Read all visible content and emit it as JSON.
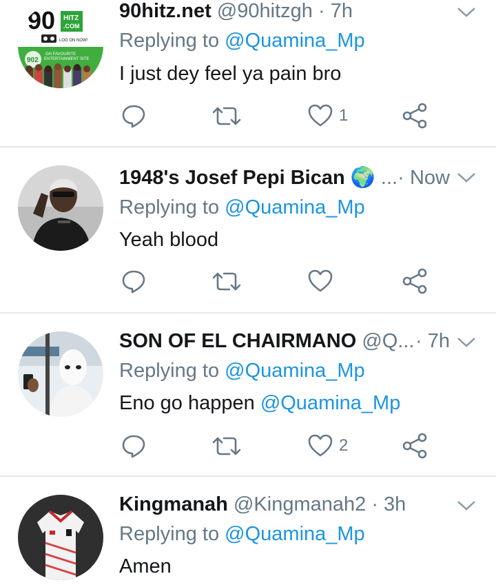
{
  "colors": {
    "link": "#1b95e0",
    "secondary": "#657786",
    "text": "#14171a",
    "divider": "#e4e8eb"
  },
  "tweets": [
    {
      "name": "90hitz.net",
      "handle": "@90hitzgh",
      "separator": "·",
      "time": "7h",
      "replying_prefix": "Replying to",
      "replying_to": "@Quamina_Mp",
      "text": "I just dey feel ya pain bro",
      "like_count": "1",
      "avatar": {
        "logo_big": "90",
        "logo_hitz": "HITZ",
        "logo_com": ".COM",
        "log_on": "LOG ON NOW!",
        "tagline_1": "GH FAVOURITE",
        "tagline_2": "ENTERTAINMENT SITE",
        "badge": "902"
      }
    },
    {
      "name": "1948's Josef Pepi Bican",
      "emoji": "🌍",
      "ellipsis": "...·",
      "time": "Now",
      "replying_prefix": "Replying to",
      "replying_to": "@Quamina_Mp",
      "text": "Yeah blood",
      "like_count": ""
    },
    {
      "name": "SON OF EL CHAIRMANO",
      "handle": "@Q...",
      "separator": "·",
      "time": "7h",
      "replying_prefix": "Replying to",
      "replying_to": "@Quamina_Mp",
      "text": "Eno go happen",
      "text_mention": "@Quamina_Mp",
      "like_count": "2"
    },
    {
      "name": "Kingmanah",
      "handle": "@Kingmanah2",
      "separator": "·",
      "time": "3h",
      "replying_prefix": "Replying to",
      "replying_to": "@Quamina_Mp",
      "text": "Amen"
    }
  ],
  "icons": {
    "reply": "reply-bubble-icon",
    "retweet": "retweet-icon",
    "like": "heart-icon",
    "share": "share-icon",
    "menu": "chevron-down-icon"
  }
}
